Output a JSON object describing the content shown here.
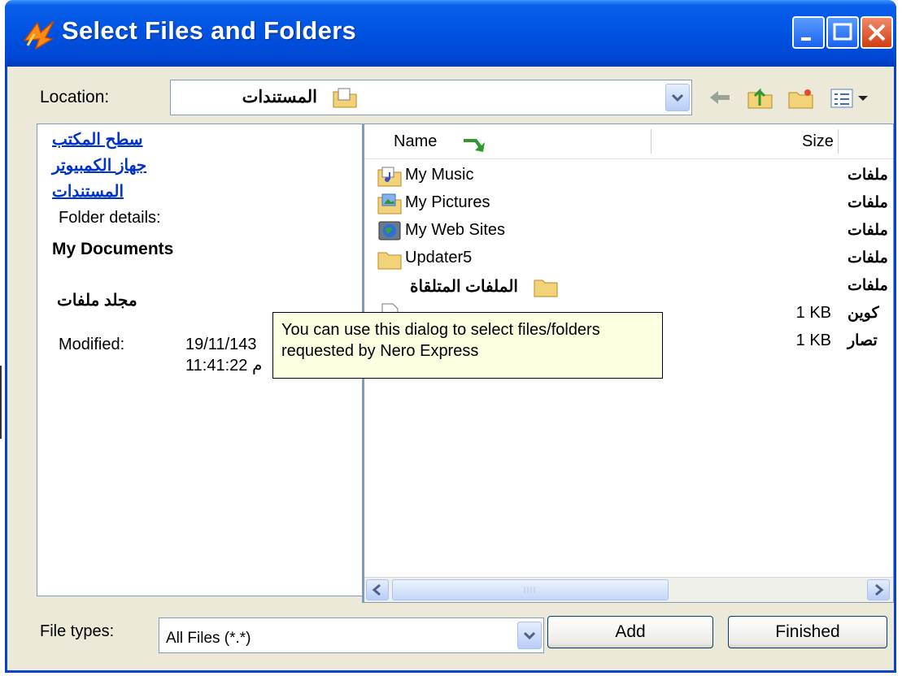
{
  "window": {
    "title": "Select Files and Folders",
    "controls": [
      "minimize",
      "maximize",
      "close"
    ]
  },
  "location": {
    "label": "Location:",
    "value": "المستندات"
  },
  "toolbar": {
    "icons": [
      "back-icon",
      "up-folder-icon",
      "new-folder-icon",
      "view-menu-icon"
    ]
  },
  "left_pane": {
    "links": [
      "سطح المكتب",
      "جهاز الكمبيوتر",
      "المستندات"
    ],
    "details_label": "Folder details:",
    "folder_name": "My Documents",
    "folder_type": "مجلد ملفات",
    "modified_label": "Modified:",
    "modified_date": "19/11/143",
    "modified_time": "11:41:22 م"
  },
  "file_list": {
    "columns": {
      "name": "Name",
      "size": "Size"
    },
    "rows": [
      {
        "name": "My Music",
        "size": "",
        "type": "ملفات",
        "icon": "music-folder-icon"
      },
      {
        "name": "My Pictures",
        "size": "",
        "type": "ملفات",
        "icon": "pictures-folder-icon"
      },
      {
        "name": "My Web Sites",
        "size": "",
        "type": "ملفات",
        "icon": "web-folder-icon"
      },
      {
        "name": "Updater5",
        "size": "",
        "type": "ملفات",
        "icon": "folder-icon"
      },
      {
        "name": "الملفات المتلقاة",
        "size": "",
        "type": "ملفات",
        "icon": "folder-icon"
      },
      {
        "name": "",
        "size": "1 KB",
        "type": "كوين",
        "icon": "file-icon"
      },
      {
        "name": "",
        "size": "1 KB",
        "type": "تصار",
        "icon": "file-icon"
      }
    ]
  },
  "tooltip": {
    "line1": "You can use this dialog to select files/folders",
    "line2": "requested by Nero Express"
  },
  "footer": {
    "file_types_label": "File types:",
    "file_types_value": "All Files (*.*)",
    "add_label": "Add",
    "finished_label": "Finished"
  }
}
